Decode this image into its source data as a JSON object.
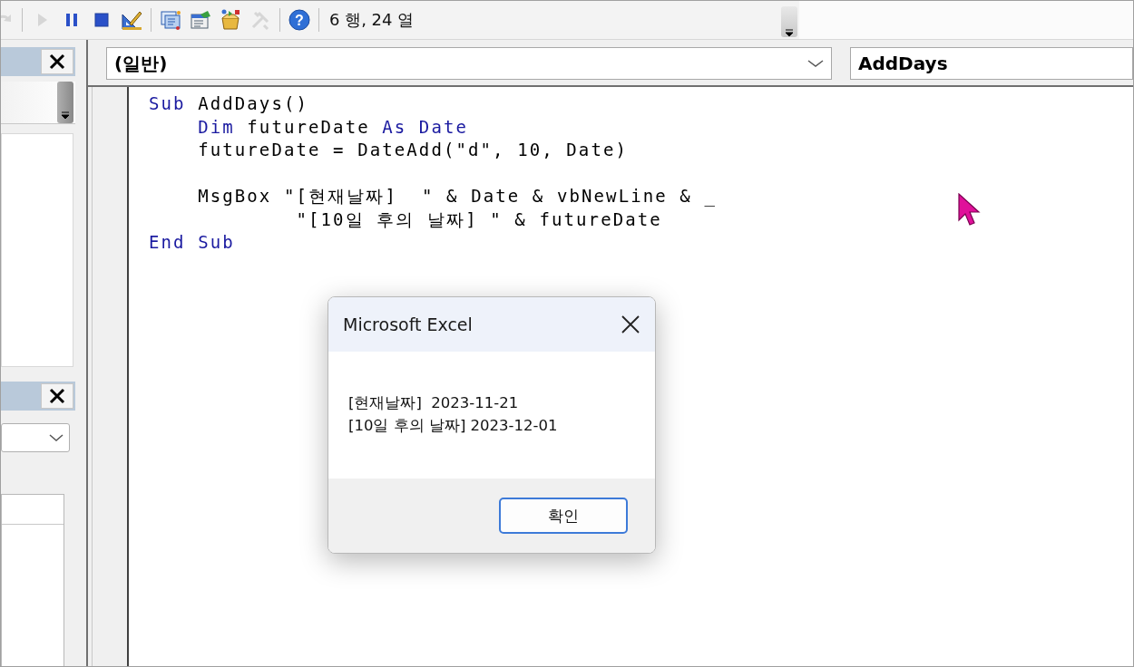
{
  "toolbar": {
    "tools": [
      {
        "kind": "redo",
        "disabled": true
      },
      {
        "kind": "separator"
      },
      {
        "kind": "run",
        "disabled": true
      },
      {
        "kind": "pause",
        "disabled": false
      },
      {
        "kind": "stop",
        "disabled": false
      },
      {
        "kind": "design",
        "disabled": false
      },
      {
        "kind": "separator"
      },
      {
        "kind": "project",
        "disabled": false
      },
      {
        "kind": "properties",
        "disabled": false
      },
      {
        "kind": "browser",
        "disabled": false
      },
      {
        "kind": "toolbox",
        "disabled": true
      },
      {
        "kind": "separator"
      },
      {
        "kind": "help",
        "disabled": false,
        "glyph": "?"
      },
      {
        "kind": "separator"
      }
    ],
    "position": "6 행, 24 열"
  },
  "code_window": {
    "object_combo": {
      "value": "(일반)"
    },
    "procedure_combo": {
      "value": "AddDays"
    },
    "lines": [
      {
        "kind": "code",
        "tokens": [
          {
            "text": "Sub",
            "kind": "keyword"
          },
          {
            "text": " AddDays()",
            "kind": "plain"
          }
        ]
      },
      {
        "kind": "code",
        "tokens": [
          {
            "text": "    Dim",
            "kind": "keyword"
          },
          {
            "text": " futureDate ",
            "kind": "plain"
          },
          {
            "text": "As Date",
            "kind": "keyword"
          }
        ]
      },
      {
        "kind": "code",
        "tokens": [
          {
            "text": "    futureDate = DateAdd(\"d\", 10, Date)",
            "kind": "plain"
          }
        ]
      },
      {
        "kind": "blank"
      },
      {
        "kind": "code",
        "tokens": [
          {
            "text": "    MsgBox \"[현재날짜]  \" & Date & vbNewLine & _",
            "kind": "plain"
          }
        ]
      },
      {
        "kind": "code",
        "tokens": [
          {
            "text": "            \"[10일 후의 날짜] \" & futureDate",
            "kind": "plain"
          }
        ]
      },
      {
        "kind": "code",
        "tokens": [
          {
            "text": "End Sub",
            "kind": "keyword"
          }
        ]
      }
    ]
  },
  "dialog": {
    "title": "Microsoft Excel",
    "message": "[현재날짜]  2023-11-21\n[10일 후의 날짜] 2023-12-01",
    "buttons": [
      "확인"
    ]
  }
}
